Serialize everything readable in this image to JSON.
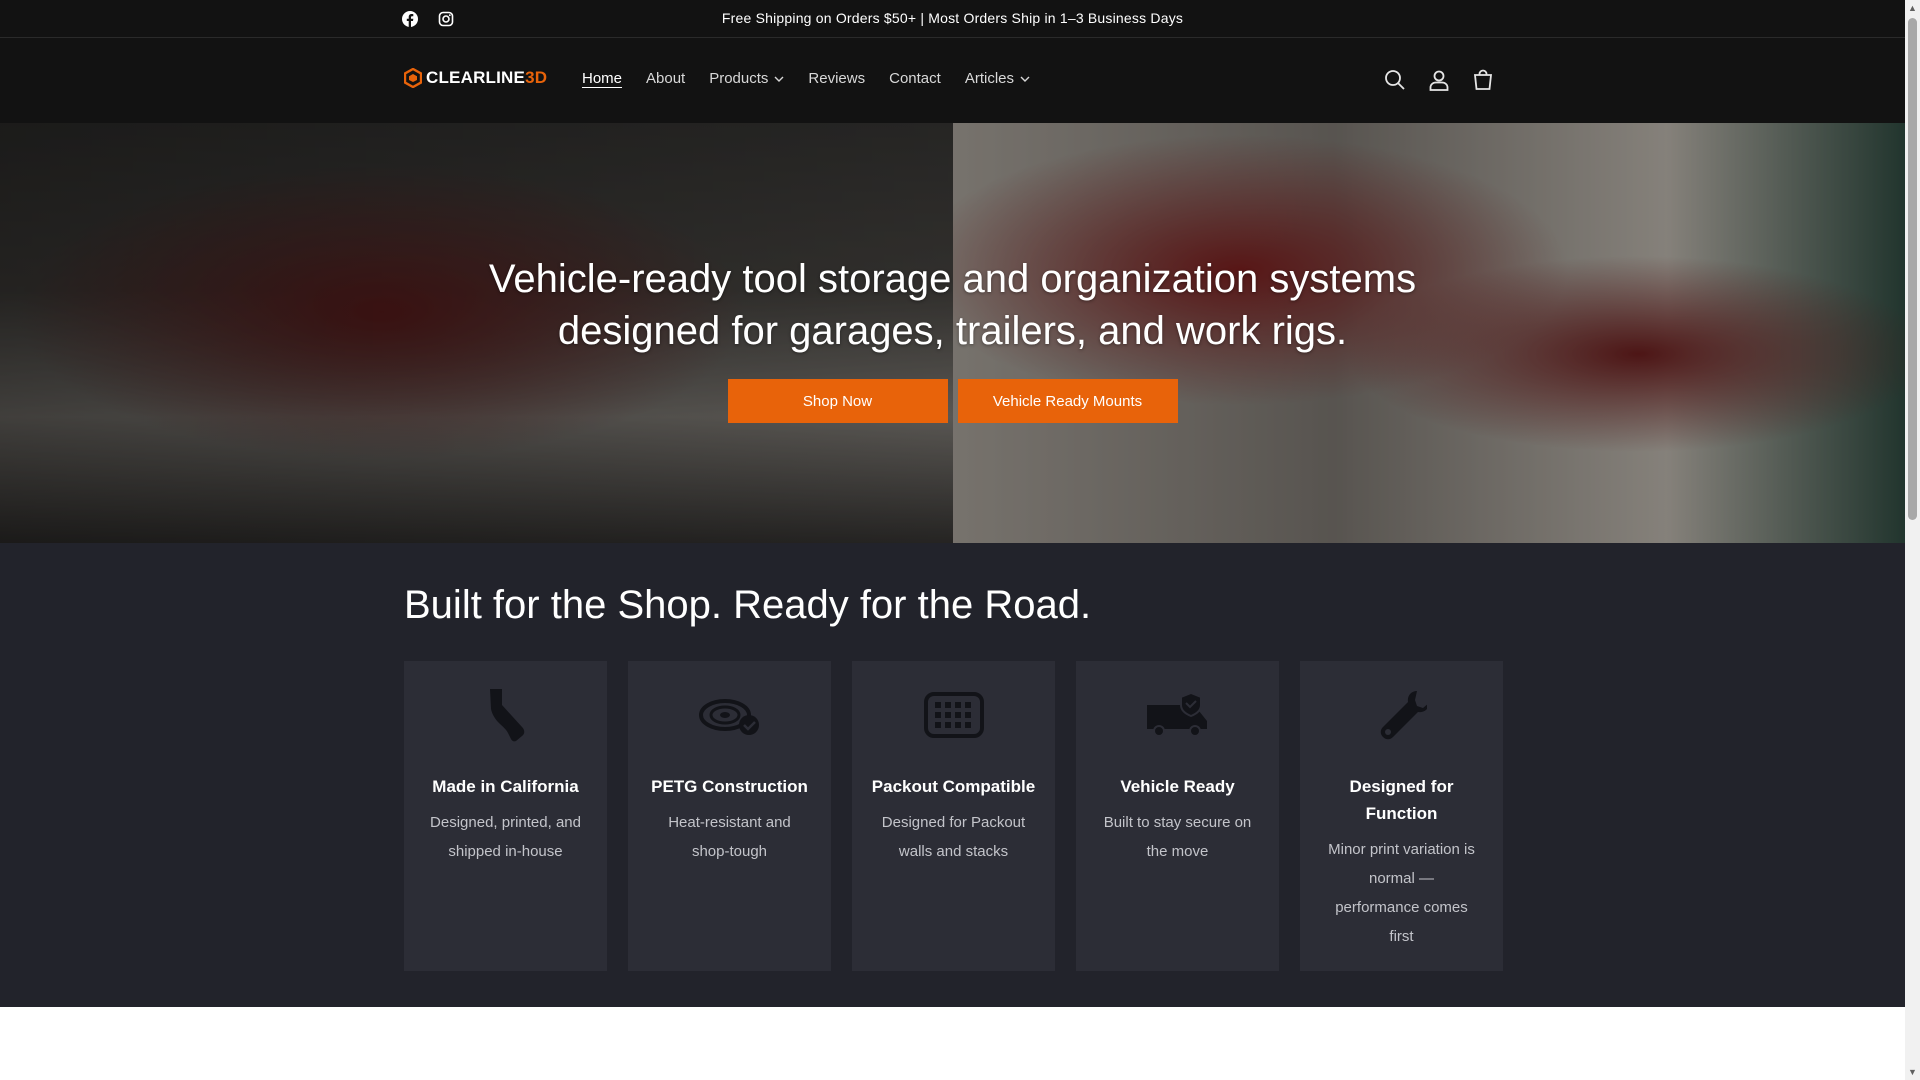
{
  "announcement": {
    "message": "Free Shipping on Orders $50+ | Most Orders Ship in 1–3 Business Days",
    "social": [
      {
        "icon": "facebook-icon"
      },
      {
        "icon": "instagram-icon"
      }
    ]
  },
  "header": {
    "logo_text_main": "CLEARLINE",
    "logo_text_accent": "3D",
    "nav": [
      {
        "label": "Home",
        "active": true
      },
      {
        "label": "About"
      },
      {
        "label": "Products",
        "dropdown": true
      },
      {
        "label": "Reviews"
      },
      {
        "label": "Contact"
      },
      {
        "label": "Articles",
        "dropdown": true
      }
    ],
    "icons": [
      "search-icon",
      "account-icon",
      "cart-icon"
    ]
  },
  "hero": {
    "title": "Vehicle-ready tool storage and organization systems designed for garages, trailers, and work rigs.",
    "buttons": [
      {
        "label": "Shop Now"
      },
      {
        "label": "Vehicle Ready Mounts"
      }
    ]
  },
  "features": {
    "heading": "Built for the Shop. Ready for the Road.",
    "cards": [
      {
        "icon": "california-icon",
        "title": "Made in California",
        "desc": "Designed, printed, and shipped in-house"
      },
      {
        "icon": "filament-spool-icon",
        "title": "PETG Construction",
        "desc": "Heat-resistant and shop-tough"
      },
      {
        "icon": "packout-grid-icon",
        "title": "Packout Compatible",
        "desc": "Designed for Packout walls and stacks"
      },
      {
        "icon": "van-check-icon",
        "title": "Vehicle Ready",
        "desc": "Built to stay secure on the move"
      },
      {
        "icon": "wrench-icon",
        "title": "Designed for Function",
        "desc": "Minor print variation is normal — performance comes first"
      }
    ]
  },
  "colors": {
    "accent": "#e8630a",
    "header_bg": "#121212",
    "features_bg": "#22232b",
    "card_bg": "#2c2d36"
  }
}
